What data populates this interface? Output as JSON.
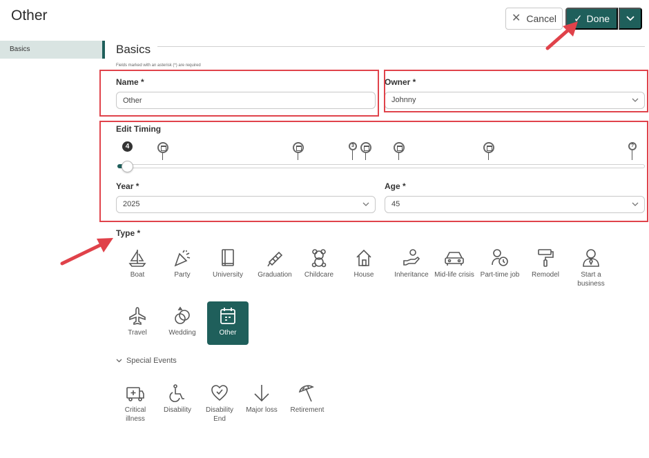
{
  "page": {
    "title": "Other"
  },
  "toolbar": {
    "cancel_label": "Cancel",
    "done_label": "Done"
  },
  "sidebar": {
    "items": [
      {
        "label": "Basics"
      }
    ]
  },
  "basics": {
    "title": "Basics",
    "required_note": "Fields marked with an asterisk (*) are required",
    "name_label": "Name *",
    "name_value": "Other",
    "owner_label": "Owner *",
    "owner_value": "Johnny",
    "timing_label": "Edit Timing",
    "timing_badge": "4",
    "small_marker_1": "3",
    "small_marker_2": "?",
    "year_label": "Year *",
    "year_value": "2025",
    "age_label": "Age *",
    "age_value": "45",
    "type_label": "Type *"
  },
  "types": [
    {
      "label": "Boat",
      "icon": "boat-icon"
    },
    {
      "label": "Party",
      "icon": "party-icon"
    },
    {
      "label": "University",
      "icon": "book-icon"
    },
    {
      "label": "Graduation",
      "icon": "diploma-icon"
    },
    {
      "label": "Childcare",
      "icon": "teddy-bear-icon"
    },
    {
      "label": "House",
      "icon": "house-icon"
    },
    {
      "label": "Inheritance",
      "icon": "hand-money-icon"
    },
    {
      "label": "Mid-life crisis",
      "icon": "car-icon"
    },
    {
      "label": "Part-time job",
      "icon": "person-clock-icon"
    },
    {
      "label": "Remodel",
      "icon": "paint-roller-icon"
    },
    {
      "label": "Start a business",
      "icon": "businessperson-icon"
    },
    {
      "label": "Travel",
      "icon": "airplane-icon"
    },
    {
      "label": "Wedding",
      "icon": "rings-icon"
    },
    {
      "label": "Other",
      "icon": "calendar-icon",
      "selected": true
    }
  ],
  "special_events": {
    "toggle_label": "Special Events",
    "items": [
      {
        "label": "Critical illness",
        "icon": "ambulance-icon"
      },
      {
        "label": "Disability",
        "icon": "wheelchair-icon"
      },
      {
        "label": "Disability End",
        "icon": "heart-icon"
      },
      {
        "label": "Major loss",
        "icon": "arrow-down-icon"
      },
      {
        "label": "Retirement",
        "icon": "beach-umbrella-icon"
      }
    ]
  },
  "colors": {
    "accent": "#1f5f5b",
    "highlight": "#e0424a",
    "sidebar_active": "#d9e4e2"
  }
}
